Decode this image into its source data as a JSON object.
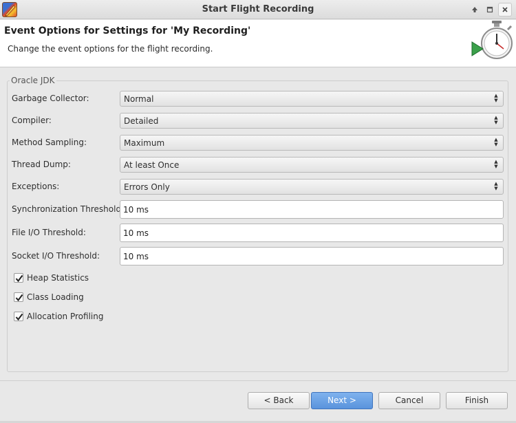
{
  "window": {
    "title": "Start Flight Recording",
    "controls": [
      "arrow-up-icon",
      "maximize-icon",
      "close-icon"
    ]
  },
  "header": {
    "title": "Event Options for Settings for 'My Recording'",
    "description": "Change the event options for the flight recording.",
    "icon": "stopwatch-play-icon"
  },
  "group": {
    "label": "Oracle JDK",
    "selects": [
      {
        "label": "Garbage Collector:",
        "value": "Normal"
      },
      {
        "label": "Compiler:",
        "value": "Detailed"
      },
      {
        "label": "Method Sampling:",
        "value": "Maximum"
      },
      {
        "label": "Thread Dump:",
        "value": "At least Once"
      },
      {
        "label": "Exceptions:",
        "value": "Errors Only"
      }
    ],
    "inputs": [
      {
        "label": "Synchronization Threshold:",
        "value": "10 ms"
      },
      {
        "label": "File I/O Threshold:",
        "value": "10 ms"
      },
      {
        "label": "Socket I/O Threshold:",
        "value": "10 ms"
      }
    ],
    "checkboxes": [
      {
        "label": "Heap Statistics",
        "checked": true
      },
      {
        "label": "Class Loading",
        "checked": true
      },
      {
        "label": "Allocation Profiling",
        "checked": true
      }
    ]
  },
  "footer": {
    "back": "< Back",
    "next": "Next >",
    "cancel": "Cancel",
    "finish": "Finish"
  },
  "colors": {
    "primary_button": "#5a93dc",
    "header_background": "#ffffff",
    "dialog_background": "#e8e8e8"
  }
}
